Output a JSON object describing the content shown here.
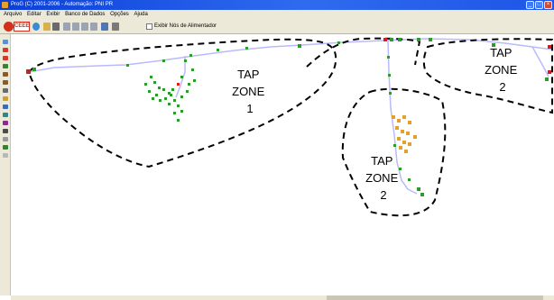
{
  "window": {
    "title": "ProG (C) 2001-2006 - Automação: PNI PR",
    "buttons": [
      "minimize",
      "maximize",
      "close"
    ]
  },
  "menu": {
    "items": [
      "Arquivo",
      "Editar",
      "Exibir",
      "Banco de Dados",
      "Opções",
      "Ajuda"
    ]
  },
  "toolbar": {
    "logo_text": "CEEE",
    "checkbox_label": "Exibir Nós de Alimentador",
    "checkbox_checked": false
  },
  "map": {
    "zones": [
      {
        "name": "zone-1",
        "lines": [
          "TAP",
          "ZONE",
          "1"
        ]
      },
      {
        "name": "zone-2-right",
        "lines": [
          "TAP",
          "ZONE",
          "2"
        ]
      },
      {
        "name": "zone-2-center",
        "lines": [
          "TAP",
          "ZONE",
          "2"
        ]
      }
    ],
    "colors": {
      "boundary": "#000000",
      "feeder_line": "#b9b9ff",
      "node_green": "#2e9a2e",
      "node_red": "#d61c1c",
      "node_orange": "#e4a028"
    }
  }
}
